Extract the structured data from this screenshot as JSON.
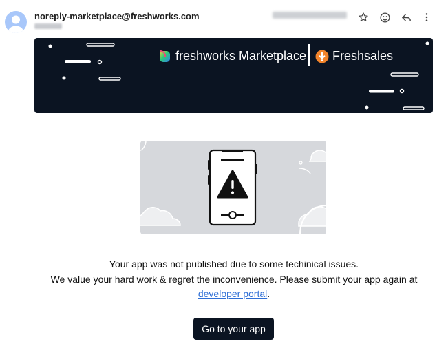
{
  "header": {
    "sender": "noreply-marketplace@freshworks.com",
    "actions": {
      "star_icon": "star-icon",
      "emoji_icon": "emoji-icon",
      "reply_icon": "reply-icon",
      "more_icon": "more-vert-icon"
    }
  },
  "banner": {
    "brand_primary": "freshworks Marketplace",
    "brand_secondary": "Freshsales",
    "bg_color": "#0b1422"
  },
  "message": {
    "line1": "Your app was not published due to some techinical issues.",
    "line2": "We value your hard work & regret the inconvenience. Please submit your app again at",
    "link_text": "developer portal",
    "after_link": "."
  },
  "cta": {
    "label": "Go to your app"
  },
  "colors": {
    "accent_link": "#2f6fd6",
    "dark": "#0b1422",
    "freshsales_orange": "#f2842b"
  }
}
